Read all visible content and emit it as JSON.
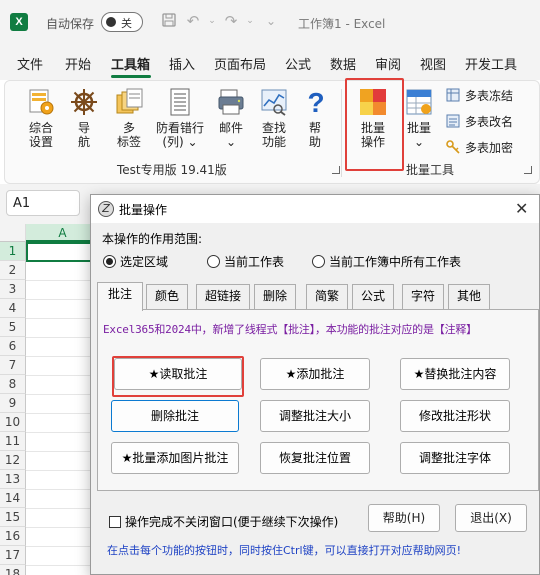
{
  "titlebar": {
    "app_logo": "X",
    "autosave_label": "自动保存",
    "autosave_state": "关",
    "doc_title": "工作簿1 - Excel",
    "icons": [
      "save-icon",
      "undo-icon",
      "redo-icon"
    ]
  },
  "menu": {
    "tabs": [
      "文件",
      "开始",
      "工具箱",
      "插入",
      "页面布局",
      "公式",
      "数据",
      "审阅",
      "视图",
      "开发工具"
    ],
    "active": "工具箱"
  },
  "ribbon": {
    "buttons": [
      {
        "label1": "综合",
        "label2": "设置",
        "icon": "gear-sheet-icon"
      },
      {
        "label1": "导",
        "label2": "航",
        "icon": "ship-wheel-icon"
      },
      {
        "label1": "多",
        "label2": "标签",
        "icon": "stacked-sheets-icon"
      },
      {
        "label1": "防看错行",
        "label2": "(列) ⌄",
        "icon": "document-lines-icon"
      },
      {
        "label1": "邮件",
        "label2": "⌄",
        "icon": "mail-printer-icon"
      },
      {
        "label1": "查找",
        "label2": "功能",
        "icon": "chart-find-icon"
      },
      {
        "label1": "帮",
        "label2": "助",
        "icon": "question-icon"
      },
      {
        "label1": "批量",
        "label2": "操作",
        "icon": "color-grid-icon"
      },
      {
        "label1": "批量",
        "label2": "⌄",
        "icon": "batch-table-icon"
      }
    ],
    "group_label_left": "Test专用版 19.41版",
    "group_label_right": "批量工具",
    "small_buttons": [
      {
        "label": "多表冻结",
        "icon": "freeze-icon"
      },
      {
        "label": "多表改名",
        "icon": "rename-icon"
      },
      {
        "label": "多表加密",
        "icon": "key-icon"
      }
    ]
  },
  "formula": {
    "cell_ref": "A1"
  },
  "grid": {
    "columns": [
      "A",
      "",
      "",
      "",
      "",
      "",
      ""
    ],
    "rows": [
      "1",
      "2",
      "3",
      "4",
      "5",
      "6",
      "7",
      "8",
      "9",
      "10",
      "11",
      "12",
      "13",
      "14",
      "15",
      "16",
      "17",
      "18"
    ]
  },
  "dialog": {
    "title": "批量操作",
    "scope_label": "本操作的作用范围:",
    "radios": [
      {
        "label": "选定区域",
        "checked": true
      },
      {
        "label": "当前工作表",
        "checked": false
      },
      {
        "label": "当前工作簿中所有工作表",
        "checked": false
      }
    ],
    "tabs": [
      "批注",
      "颜色",
      "超链接",
      "删除",
      "简繁",
      "公式",
      "字符",
      "其他"
    ],
    "active_tab": "批注",
    "notice": "Excel365和2024中，新增了线程式【批注】，本功能的批注对应的是【注释】",
    "buttons": [
      [
        "★读取批注",
        "★添加批注",
        "★替换批注内容"
      ],
      [
        "删除批注",
        "调整批注大小",
        "修改批注形状"
      ],
      [
        "★批量添加图片批注",
        "恢复批注位置",
        "调整批注字体"
      ]
    ],
    "keep_open_label": "操作完成不关闭窗口(便于继续下次操作)",
    "help_button": "帮助(H)",
    "exit_button": "退出(X)",
    "footer_tip": "在点击每个功能的按钮时，同时按住Ctrl键，可以直接打开对应帮助网页!",
    "colors": {
      "notice": "#7a1fa2",
      "tip": "#1f43c4",
      "highlight": "#e0403a",
      "accent": "#107c41"
    }
  }
}
